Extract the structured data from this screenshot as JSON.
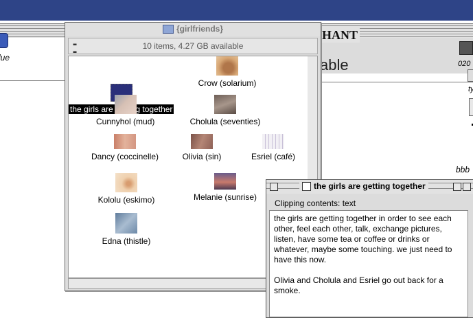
{
  "finder": {
    "title": "{girlfriends}",
    "info": "10 items, 4.27 GB available",
    "items": [
      {
        "label": "the girls are getting together",
        "selected": true,
        "color": "#2a2f7a"
      },
      {
        "label": "Crow (solarium)",
        "color": "#c9955f"
      },
      {
        "label": "Cunnyhol (mud)",
        "color": "#c7b3a8"
      },
      {
        "label": "Cholula (seventies)",
        "color": "#8a7a6e"
      },
      {
        "label": "Dancy (coccinelle)",
        "color": "#d9a28a"
      },
      {
        "label": "Olivia (sin)",
        "color": "#9b6a5c"
      },
      {
        "label": "Esriel (café)",
        "color": "#e9e6ef"
      },
      {
        "label": "Kololu (eskimo)",
        "color": "#e8c19a"
      },
      {
        "label": "Melanie (sunrise)",
        "color": "#a9625e"
      },
      {
        "label": "Edna (thistle)",
        "color": "#8aa0b8"
      }
    ]
  },
  "clipping": {
    "title": "the girls are getting together",
    "subheader": "Clipping contents: text",
    "paragraphs": [
      "the girls are getting together in order to see each other, feel each other, talk, exchange pictures, listen, have some tea or coffee or drinks or whatever, maybe some touching. we just need to have this now.",
      "Olivia and Cholula and Esriel go out back for a smoke."
    ]
  },
  "background": {
    "left_label": "lue",
    "main_title": "HANT",
    "main_text": "able",
    "right_labels": [
      "020",
      "ty",
      "bbb"
    ]
  },
  "colors": {
    "menubar": "#2e4487",
    "selection": "#000000"
  }
}
